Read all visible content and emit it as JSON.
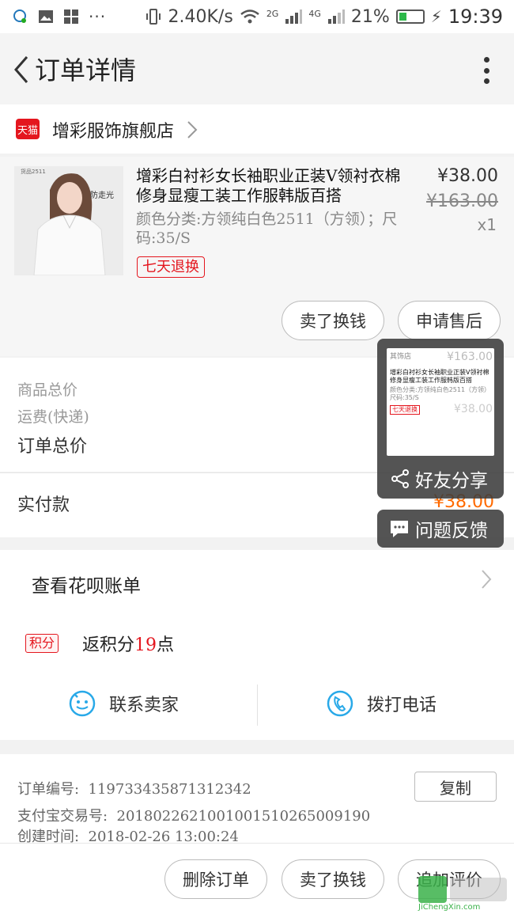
{
  "status_bar": {
    "network_speed": "2.40K/s",
    "sim1": "2G",
    "sim2": "4G",
    "battery": "21%",
    "time": "19:39",
    "dots": "···"
  },
  "header": {
    "title": "订单详情"
  },
  "store": {
    "badge": "天猫",
    "name": "增彩服饰旗舰店"
  },
  "product": {
    "thumb_caption": "防走光",
    "thumb_tag": "货品2511",
    "title": "增彩白衬衫女长袖职业正装V领衬衣棉修身显瘦工装工作服韩版百搭",
    "attrs": "颜色分类:方领纯白色2511（方领）；尺码:35/S",
    "return_badge": "七天退换",
    "price_now": "¥38.00",
    "price_old": "¥163.00",
    "qty": "x1"
  },
  "product_buttons": {
    "sell": "卖了换钱",
    "after_sale": "申请售后"
  },
  "summary": {
    "goods_total_label": "商品总价",
    "shipping_label": "运费(快递)",
    "order_total_label": "订单总价",
    "paid_label": "实付款",
    "paid_amount": "¥38.00"
  },
  "huabei": {
    "label": "查看花呗账单"
  },
  "points": {
    "badge": "积分",
    "prefix": "返积分",
    "value": "19",
    "suffix": "点"
  },
  "contact": {
    "seller": "联系卖家",
    "phone": "拨打电话"
  },
  "order_info": {
    "order_no_label": "订单编号:",
    "order_no": "119733435871312342",
    "alipay_label": "支付宝交易号:",
    "alipay_no": "2018022621001001510265009190",
    "created_label": "创建时间:",
    "created": "2018-02-26 13:00:24",
    "copy": "复制"
  },
  "bottom_buttons": {
    "delete": "删除订单",
    "sell": "卖了换钱",
    "review": "追加评价"
  },
  "float_share": {
    "label": "好友分享",
    "preview_store": "其饰店",
    "preview_title": "增彩白衬衫女长袖职业正装V领衬棉修身显瘦工装工作服韩版百搭",
    "preview_attrs": "颜色分类:方领纯白色2511（方领）尺码:35/S",
    "preview_badge": "七天退换",
    "preview_price_old": "¥163.00",
    "preview_price": "¥38.00"
  },
  "float_feedback": {
    "label": "问题反馈"
  },
  "watermark": {
    "text": "JiChengXin.com"
  },
  "colors": {
    "tmall_red": "#e4161e",
    "price_orange": "#ff6a00",
    "contact_blue": "#29a9e8"
  }
}
